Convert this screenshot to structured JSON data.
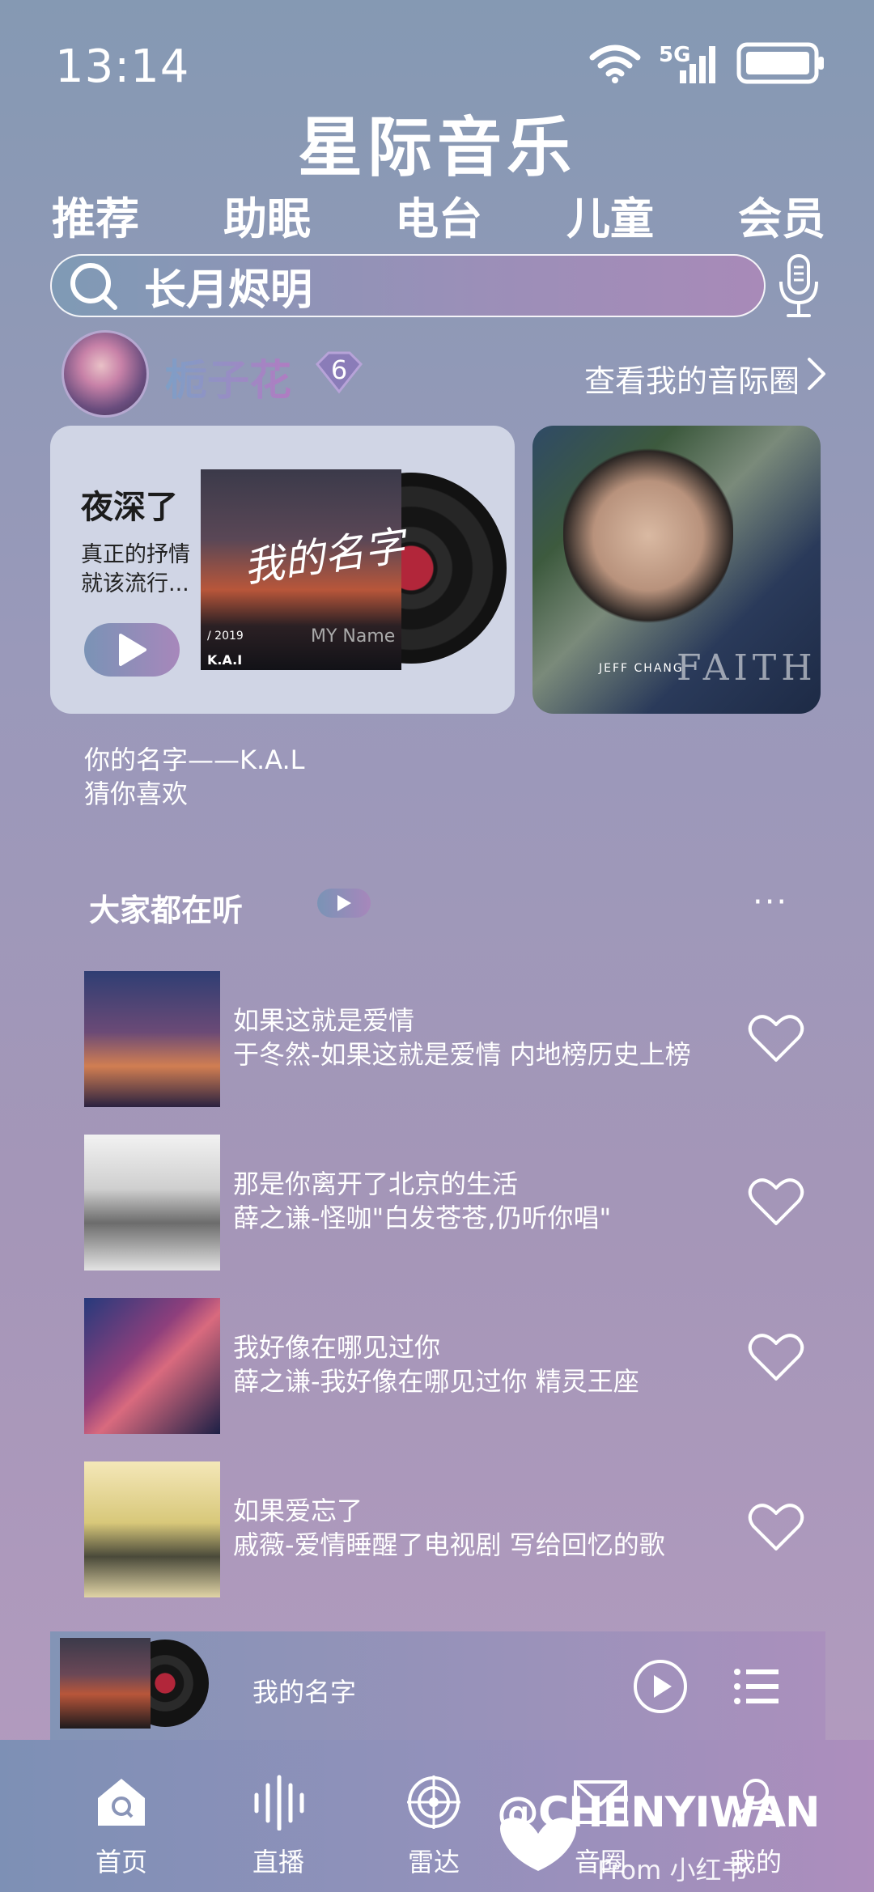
{
  "status": {
    "time": "13:14",
    "network": "5G"
  },
  "app": {
    "title": "星际音乐"
  },
  "tabs": [
    "推荐",
    "助眠",
    "电台",
    "儿童",
    "会员"
  ],
  "search": {
    "value": "长月烬明"
  },
  "profile": {
    "username": "栀子花",
    "level": "6",
    "link_label": "查看我的音际圈"
  },
  "featured": {
    "title": "夜深了",
    "subtitle_line1": "真正的抒情",
    "subtitle_line2": "就该流行...",
    "cover_script": "我的名字",
    "cover_year": "/ 2019",
    "cover_artist": "K.A.I",
    "cover_my": "MY Name",
    "side_cover_text": "FAITH",
    "side_cover_artist": "JEFF CHANG"
  },
  "now_info": {
    "line1": "你的名字——K.A.L",
    "line2": "猜你喜欢"
  },
  "section": {
    "title": "大家都在听",
    "more": "···"
  },
  "songs": [
    {
      "title": "如果这就是爱情",
      "subtitle": "于冬然-如果这就是爱情 内地榜历史上榜"
    },
    {
      "title": "那是你离开了北京的生活",
      "subtitle": "薛之谦-怪咖\"白发苍苍,仍听你唱\""
    },
    {
      "title": "我好像在哪见过你",
      "subtitle": "薛之谦-我好像在哪见过你 精灵王座"
    },
    {
      "title": "如果爱忘了",
      "subtitle": "戚薇-爱情睡醒了电视剧 写给回忆的歌"
    }
  ],
  "mini_player": {
    "song": "我的名字"
  },
  "nav": [
    {
      "label": "首页",
      "icon": "home-icon"
    },
    {
      "label": "直播",
      "icon": "live-icon"
    },
    {
      "label": "雷达",
      "icon": "radar-icon"
    },
    {
      "label": "音圈",
      "icon": "mail-icon"
    },
    {
      "label": "我的",
      "icon": "user-icon"
    }
  ],
  "watermark": {
    "handle": "@CHENYIWAN",
    "source": "From 小红书"
  }
}
